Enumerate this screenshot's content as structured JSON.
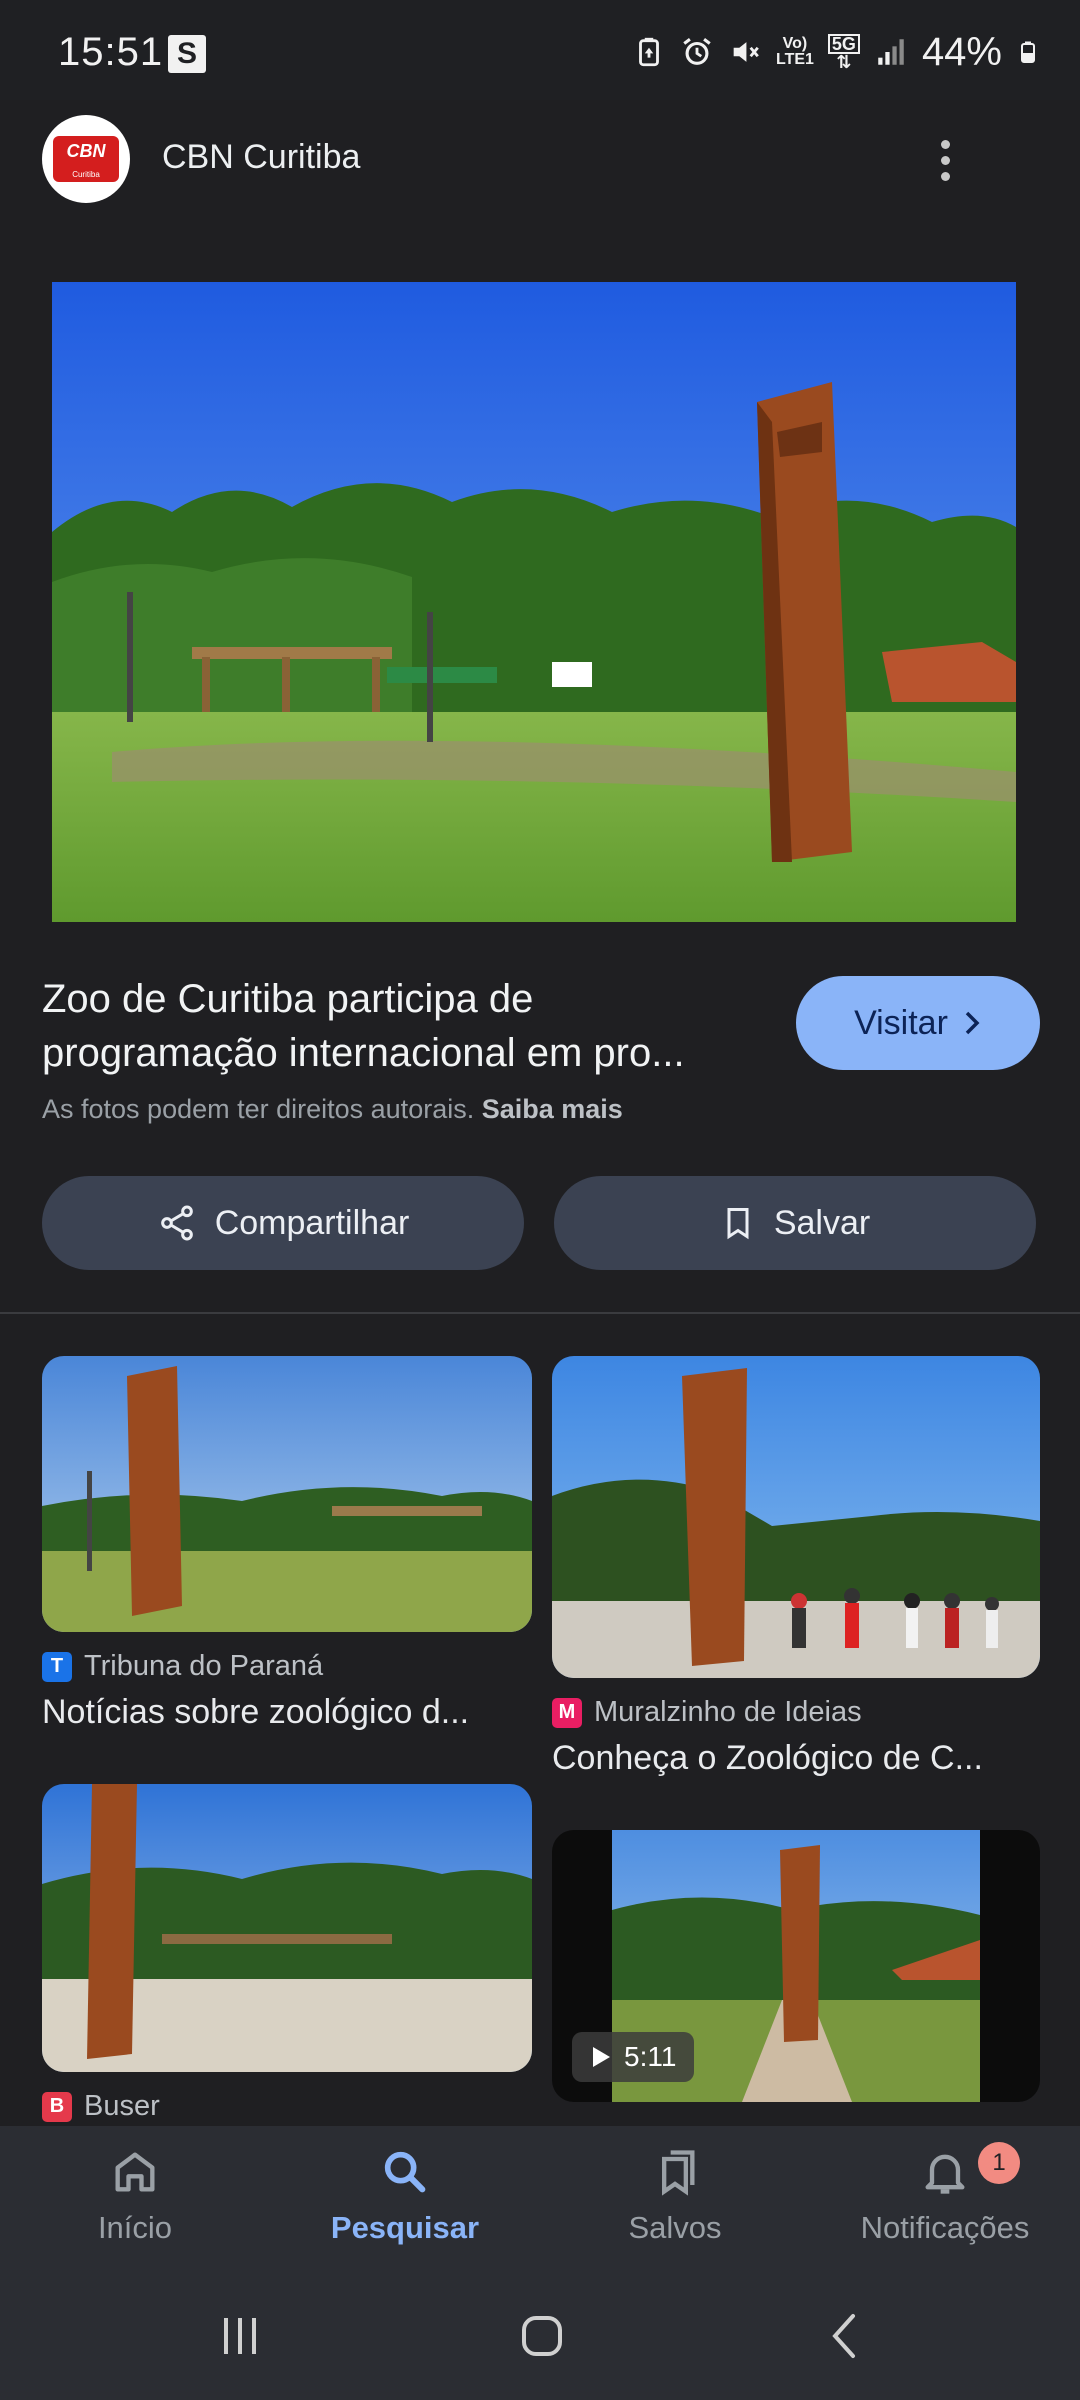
{
  "status_bar": {
    "time": "15:51",
    "notification_letter": "S",
    "network_label_top": "Vo)",
    "network_label_bottom": "LTE1",
    "fiveg": "5G",
    "battery": "44%"
  },
  "header": {
    "publisher_logo_text": "CBN",
    "publisher_logo_sub": "Curitiba",
    "publisher_name": "CBN Curitiba"
  },
  "article": {
    "title_line1": "Zoo de Curitiba participa de",
    "title_line2": "programação internacional em pro...",
    "visit_label": "Visitar",
    "copyright_text": "As fotos podem ter direitos autorais.",
    "learn_more": "Saiba mais",
    "share_label": "Compartilhar",
    "save_label": "Salvar"
  },
  "related": [
    {
      "source": "Tribuna do Paraná",
      "title": "Notícias sobre zoológico d...",
      "source_icon": "T",
      "icon_color": "#1a73e8"
    },
    {
      "source": "Muralzinho de Ideias",
      "title": "Conheça o Zoológico de C...",
      "source_icon": "M",
      "icon_color": "#e91e63"
    },
    {
      "source": "Buser",
      "title": "",
      "source_icon": "B",
      "icon_color": "#e5394b"
    },
    {
      "source": "",
      "title": "",
      "video_duration": "5:11"
    }
  ],
  "bottom_nav": {
    "items": [
      {
        "label": "Início",
        "icon": "home-icon"
      },
      {
        "label": "Pesquisar",
        "icon": "search-icon"
      },
      {
        "label": "Salvos",
        "icon": "bookmarks-icon"
      },
      {
        "label": "Notificações",
        "icon": "bell-icon"
      }
    ],
    "active": "Pesquisar",
    "notification_count": "1"
  },
  "colors": {
    "accent": "#8ab4f8",
    "background": "#1f1f22",
    "button_bg": "#3b4252"
  }
}
